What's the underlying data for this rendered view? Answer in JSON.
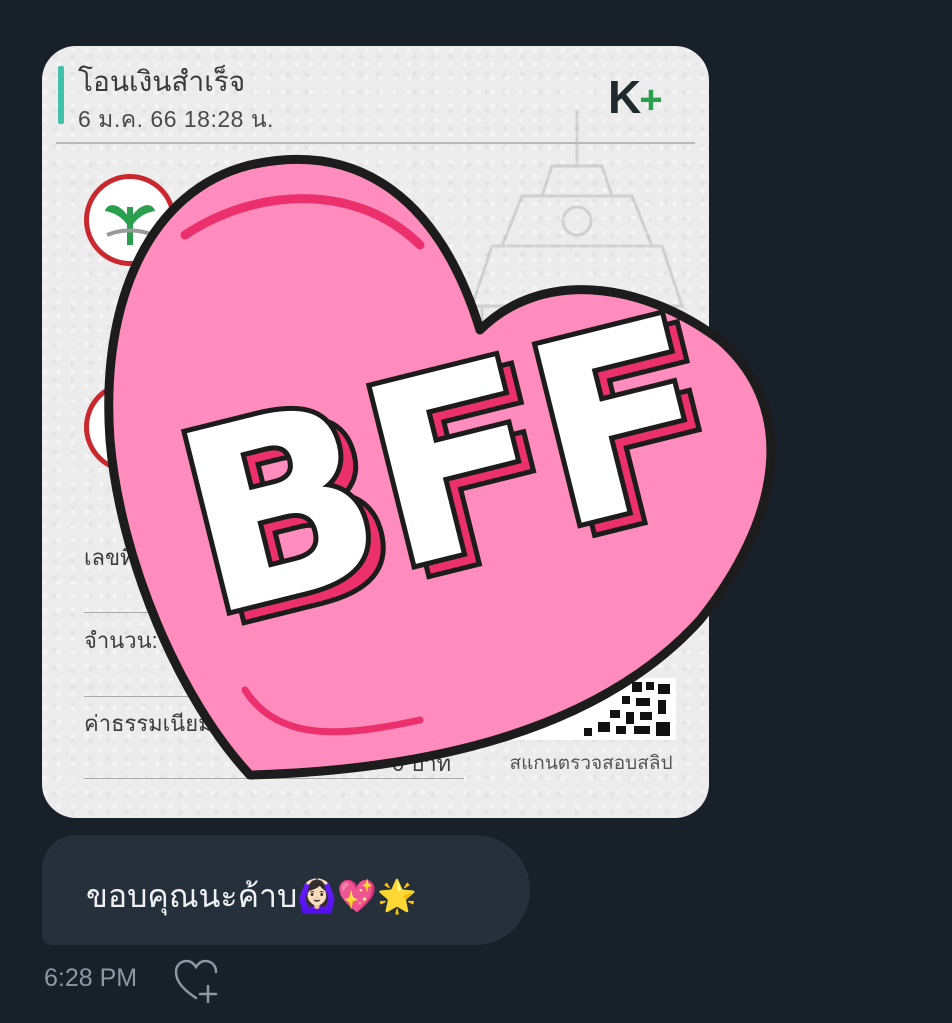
{
  "slip": {
    "title": "โอนเงินสำเร็จ",
    "date": "6 ม.ค. 66  18:28 น.",
    "logo_text": "K",
    "logo_plus": "+",
    "fields": {
      "ref_label": "เลขที่",
      "amount_label": "จำนวน:",
      "fee_label": "ค่าธรรมเนียม",
      "fee_value": "0 บาท"
    },
    "scan_label": "สแกนตรวจสอบสลิป",
    "colors": {
      "accent": "#3ec1a8",
      "bank_red": "#c8282e",
      "bank_green": "#2aa04f"
    }
  },
  "sticker": {
    "text": "BFF",
    "colors": {
      "heart": "#ff8cbd",
      "shadow": "#ec2f6d",
      "outline": "#1c1c1c"
    }
  },
  "message": {
    "text": "ขอบคุณนะค้าบ🙆🏻‍♀️💖🌟"
  },
  "meta": {
    "time": "6:28 PM",
    "react_icon": "heart-add-icon"
  }
}
